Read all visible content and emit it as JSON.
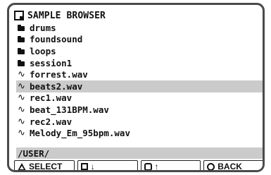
{
  "title": "SAMPLE BROWSER",
  "icons": {
    "title": "sample-browser-icon",
    "folder": "folder-icon",
    "audio": "waveform-icon"
  },
  "entries": [
    {
      "label": "drums",
      "type": "folder"
    },
    {
      "label": "foundsound",
      "type": "folder"
    },
    {
      "label": "loops",
      "type": "folder"
    },
    {
      "label": "session1",
      "type": "folder"
    },
    {
      "label": "forrest.wav",
      "type": "audio"
    },
    {
      "label": "beats2.wav",
      "type": "audio",
      "selected": true
    },
    {
      "label": "rec1.wav",
      "type": "audio"
    },
    {
      "label": "beat_131BPM.wav",
      "type": "audio"
    },
    {
      "label": "rec2.wav",
      "type": "audio"
    },
    {
      "label": "Melody_Em_95bpm.wav",
      "type": "audio"
    }
  ],
  "path": "/USER/",
  "buttons": [
    {
      "icon": "triangle-icon",
      "label": "SELECT"
    },
    {
      "icon": "square-icon",
      "label": "↓"
    },
    {
      "icon": "octagon-icon",
      "label": "↑"
    },
    {
      "icon": "circle-icon",
      "label": "BACK"
    }
  ],
  "colors": {
    "selection": "#cbcbcb",
    "border": "#4a4a4a",
    "text": "#111111"
  }
}
